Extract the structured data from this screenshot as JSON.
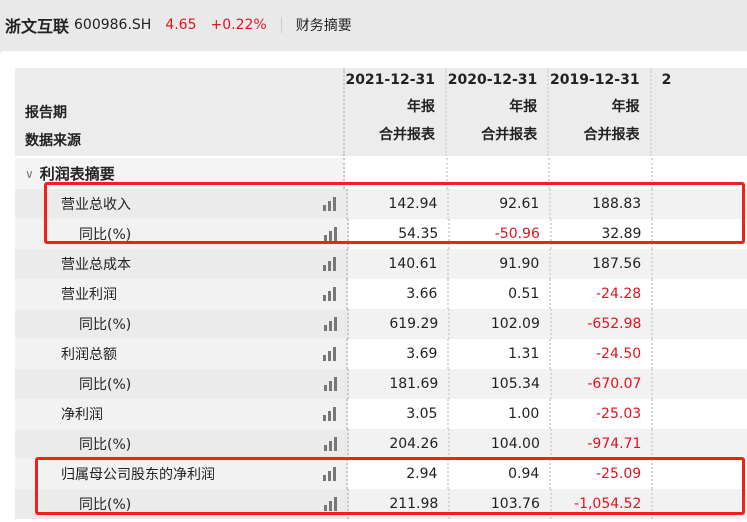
{
  "header": {
    "stock_name": "浙文互联",
    "code": "600986.SH",
    "price": "4.65",
    "change": "+0.22%",
    "section": "财务摘要"
  },
  "table": {
    "period_label": "报告期",
    "source_label": "数据来源",
    "columns": [
      {
        "date": "2021-12-31",
        "type": "年报",
        "source": "合并报表"
      },
      {
        "date": "2020-12-31",
        "type": "年报",
        "source": "合并报表"
      },
      {
        "date": "2019-12-31",
        "type": "年报",
        "source": "合并报表"
      },
      {
        "date": "2"
      }
    ],
    "group": "利润表摘要",
    "rows": [
      {
        "label": "营业总收入",
        "values": [
          "142.94",
          "92.61",
          "188.83"
        ]
      },
      {
        "label": "同比(%)",
        "values": [
          "54.35",
          "-50.96",
          "32.89"
        ]
      },
      {
        "label": "营业总成本",
        "values": [
          "140.61",
          "91.90",
          "187.56"
        ]
      },
      {
        "label": "营业利润",
        "values": [
          "3.66",
          "0.51",
          "-24.28"
        ]
      },
      {
        "label": "同比(%)",
        "values": [
          "619.29",
          "102.09",
          "-652.98"
        ]
      },
      {
        "label": "利润总额",
        "values": [
          "3.69",
          "1.31",
          "-24.50"
        ]
      },
      {
        "label": "同比(%)",
        "values": [
          "181.69",
          "105.34",
          "-670.07"
        ]
      },
      {
        "label": "净利润",
        "values": [
          "3.05",
          "1.00",
          "-25.03"
        ]
      },
      {
        "label": "同比(%)",
        "values": [
          "204.26",
          "104.00",
          "-974.71"
        ]
      },
      {
        "label": "归属母公司股东的净利润",
        "values": [
          "2.94",
          "0.94",
          "-25.09"
        ]
      },
      {
        "label": "同比(%)",
        "values": [
          "211.98",
          "103.76",
          "-1,054.52"
        ]
      }
    ]
  },
  "colors": {
    "negative": "#e0141e",
    "highlight": "#f0211a"
  }
}
